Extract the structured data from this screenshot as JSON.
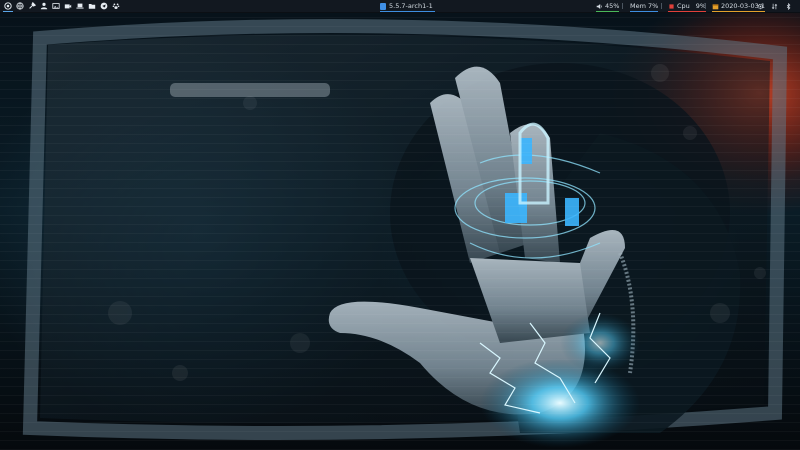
{
  "panel": {
    "launchers": [
      {
        "icon": "applications-menu-icon"
      },
      {
        "icon": "browser-icon"
      },
      {
        "icon": "tools-icon"
      },
      {
        "icon": "user-icon"
      },
      {
        "icon": "image-viewer-icon"
      },
      {
        "icon": "video-icon"
      },
      {
        "icon": "laptop-icon"
      },
      {
        "icon": "folder-icon"
      },
      {
        "icon": "telegram-icon"
      },
      {
        "icon": "paw-icon"
      }
    ],
    "window_title": "5.5.7-arch1-1",
    "volume": {
      "label": "45%",
      "icon": "volume-icon",
      "color": "#49b85a"
    },
    "memory": {
      "label": "Mem 7%",
      "color": "#3d8ee0"
    },
    "cpu": {
      "label": "Cpu",
      "value": "9%",
      "color": "#e0403a"
    },
    "date": {
      "label": "2020-03-03 1",
      "icon": "calendar-icon",
      "color": "#e3a02b"
    },
    "tray": [
      {
        "icon": "gear-icon"
      },
      {
        "icon": "network-icon"
      },
      {
        "icon": "bluetooth-icon"
      }
    ]
  },
  "wallpaper": {
    "description_icon": "hand-hologram-wallpaper",
    "accent": "#5ad3ff"
  }
}
